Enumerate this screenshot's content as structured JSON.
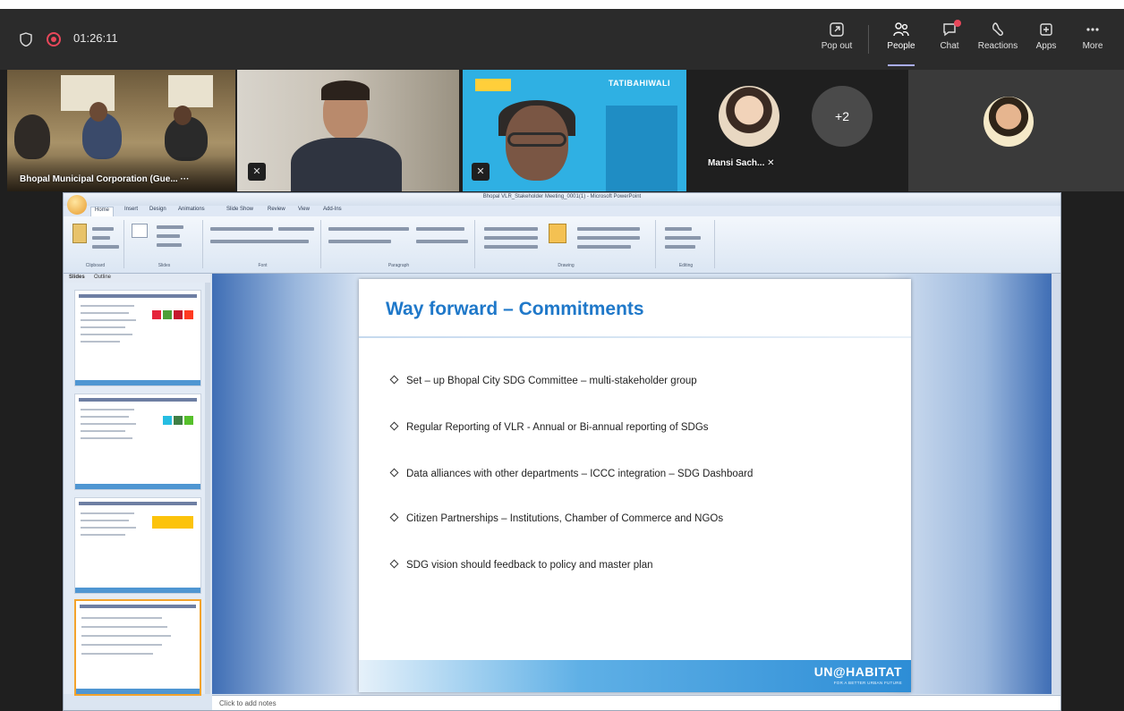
{
  "meeting": {
    "timer": "01:26:11",
    "toolbar": [
      {
        "id": "popout",
        "label": "Pop out",
        "icon": "popout-icon"
      },
      {
        "id": "people",
        "label": "People",
        "icon": "people-icon"
      },
      {
        "id": "chat",
        "label": "Chat",
        "icon": "chat-icon"
      },
      {
        "id": "reactions",
        "label": "Reactions",
        "icon": "reactions-icon"
      },
      {
        "id": "apps",
        "label": "Apps",
        "icon": "apps-icon"
      },
      {
        "id": "more",
        "label": "More",
        "icon": "more-icon"
      }
    ]
  },
  "participants": {
    "room_name": "Bhopal Municipal Corporation (Gue...",
    "room_more": "···",
    "banner": "TATIBAHIWALI",
    "mansi_name": "Mansi Sach...",
    "overflow_count": "+2"
  },
  "ppt": {
    "window_title": "Bhopal VLR_Stakeholder Meeting_0001(1) - Microsoft PowerPoint",
    "tabs": [
      "Home",
      "Insert",
      "Design",
      "Animations",
      "Slide Show",
      "Review",
      "View",
      "Add-Ins"
    ],
    "ribbon_groups": [
      "Clipboard",
      "Slides",
      "Font",
      "Paragraph",
      "Drawing",
      "Editing"
    ],
    "panel_tabs": [
      "Slides",
      "Outline"
    ],
    "notes_placeholder": "Click to add notes"
  },
  "slide": {
    "title": "Way forward – Commitments",
    "bullets": [
      "Set – up Bhopal City SDG Committee – multi-stakeholder group",
      "Regular Reporting of VLR - Annual or Bi-annual reporting of SDGs",
      "Data alliances with other departments – ICCC integration – SDG Dashboard",
      "Citizen Partnerships – Institutions, Chamber of Commerce and NGOs",
      "SDG vision should feedback to policy and master plan"
    ],
    "footer_logo": "UN@HABITAT",
    "footer_tagline": "FOR A BETTER URBAN FUTURE"
  },
  "colors": {
    "title_blue": "#1f78c9",
    "teams_bg": "#1f1f1f",
    "record_red": "#e8475a"
  }
}
